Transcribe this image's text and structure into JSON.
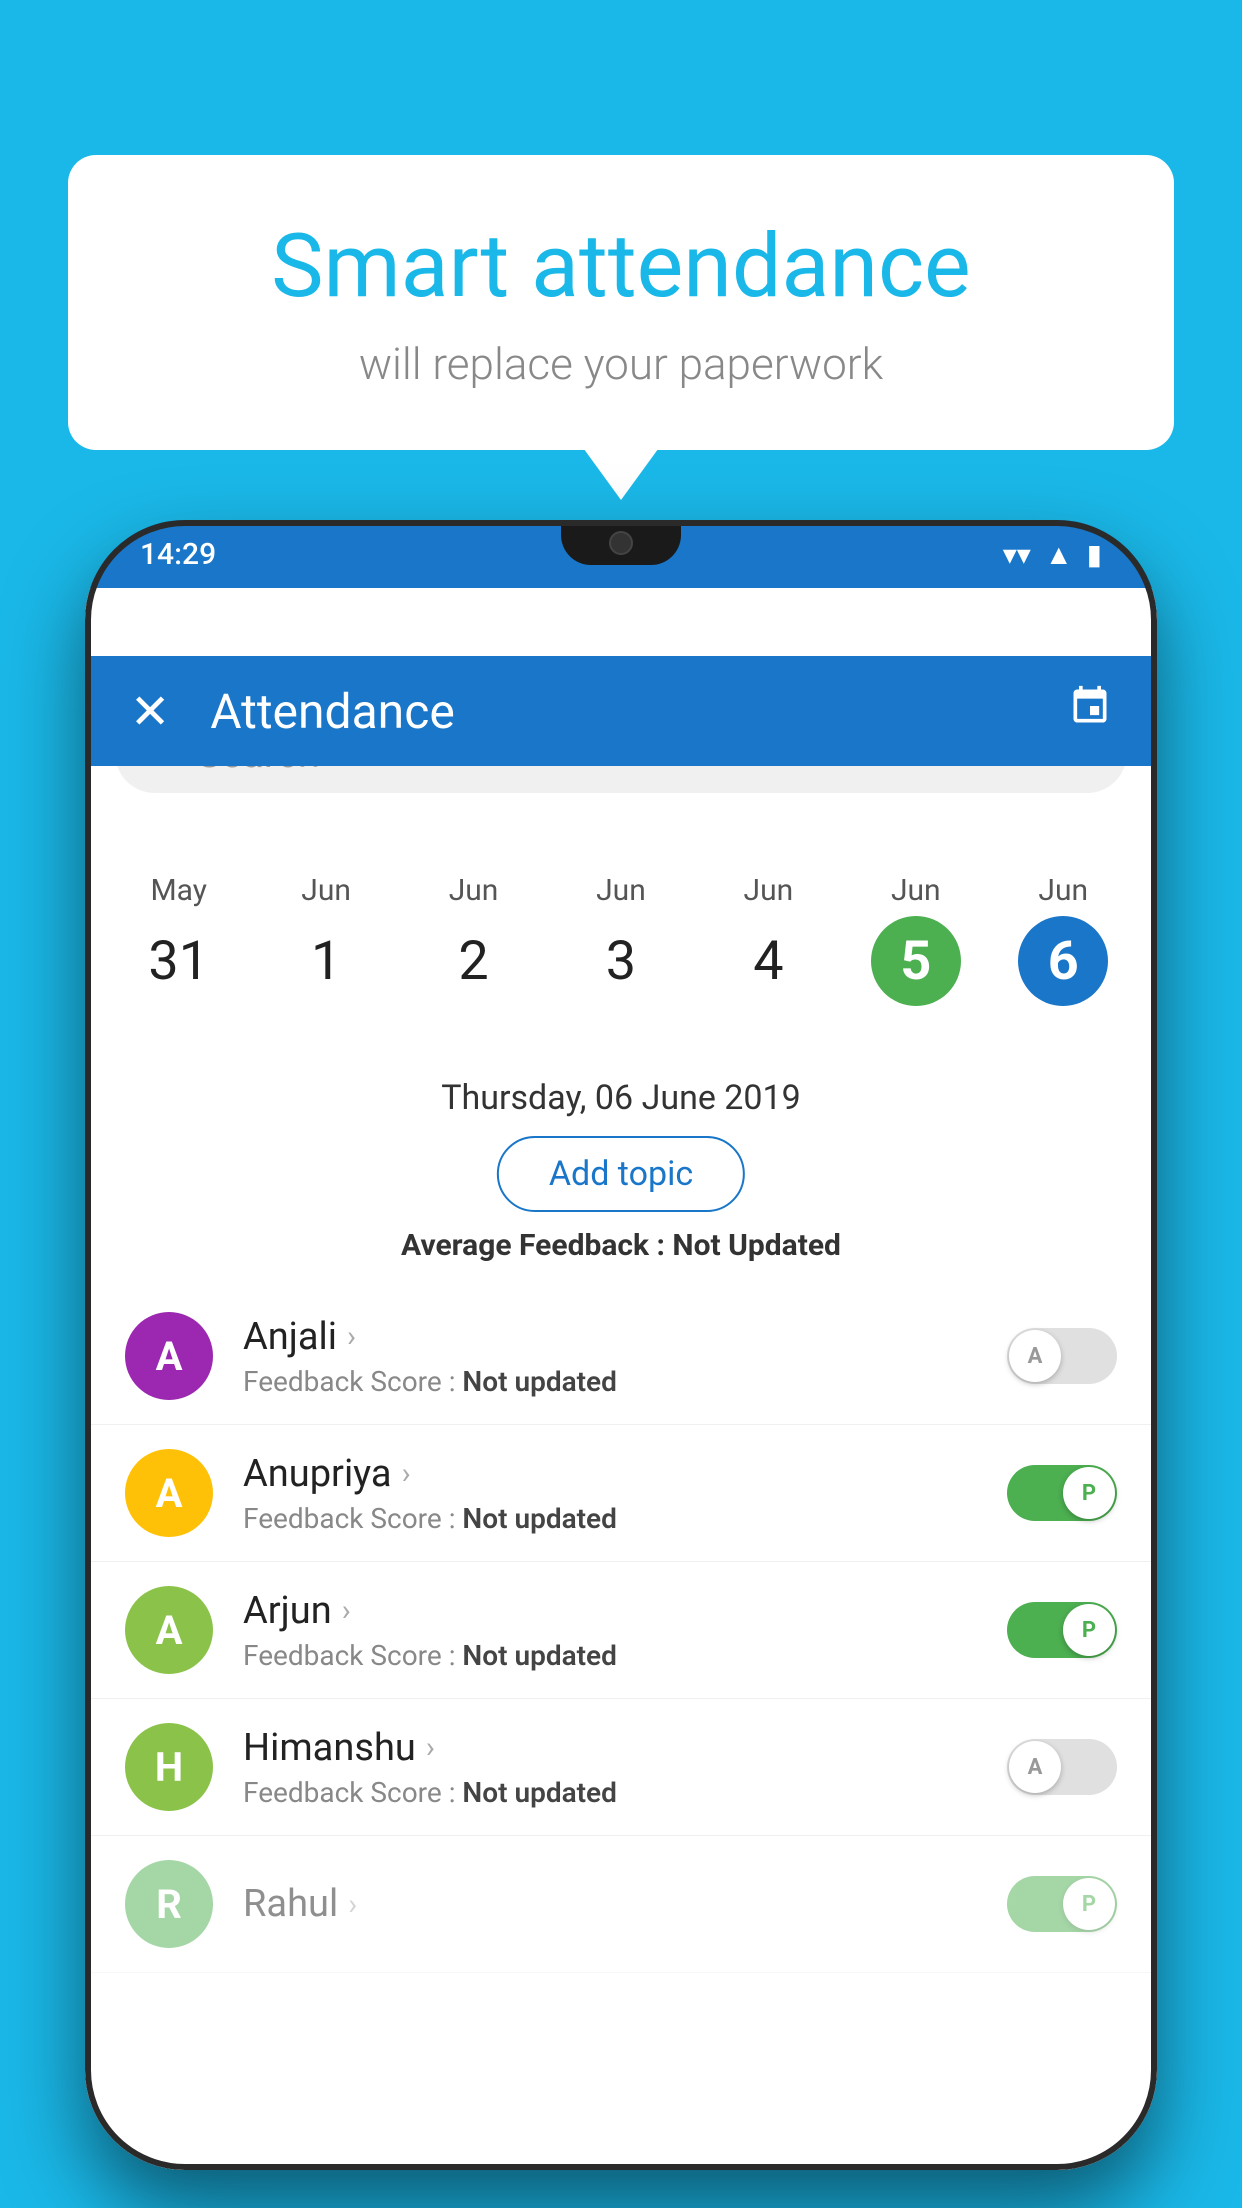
{
  "background": {
    "color": "#1ab8e8"
  },
  "speech_bubble": {
    "title": "Smart attendance",
    "subtitle": "will replace your paperwork"
  },
  "status_bar": {
    "time": "14:29",
    "wifi_icon": "▼",
    "signal_icon": "▲",
    "battery_icon": "▮"
  },
  "app_bar": {
    "title": "Attendance",
    "close_icon": "✕",
    "calendar_icon": "📅"
  },
  "search": {
    "placeholder": "Search"
  },
  "calendar": {
    "days": [
      {
        "month": "May",
        "num": "31",
        "style": "normal"
      },
      {
        "month": "Jun",
        "num": "1",
        "style": "normal"
      },
      {
        "month": "Jun",
        "num": "2",
        "style": "normal"
      },
      {
        "month": "Jun",
        "num": "3",
        "style": "normal"
      },
      {
        "month": "Jun",
        "num": "4",
        "style": "normal"
      },
      {
        "month": "Jun",
        "num": "5",
        "style": "green"
      },
      {
        "month": "Jun",
        "num": "6",
        "style": "blue"
      }
    ]
  },
  "selected_date": "Thursday, 06 June 2019",
  "add_topic_label": "Add topic",
  "avg_feedback_label": "Average Feedback :",
  "avg_feedback_value": "Not Updated",
  "students": [
    {
      "name": "Anjali",
      "avatar_letter": "A",
      "avatar_color": "#9c27b0",
      "feedback_label": "Feedback Score :",
      "feedback_value": "Not updated",
      "toggle_state": "off",
      "toggle_letter": "A"
    },
    {
      "name": "Anupriya",
      "avatar_letter": "A",
      "avatar_color": "#ffc107",
      "feedback_label": "Feedback Score :",
      "feedback_value": "Not updated",
      "toggle_state": "on",
      "toggle_letter": "P"
    },
    {
      "name": "Arjun",
      "avatar_letter": "A",
      "avatar_color": "#8bc34a",
      "feedback_label": "Feedback Score :",
      "feedback_value": "Not updated",
      "toggle_state": "on",
      "toggle_letter": "P"
    },
    {
      "name": "Himanshu",
      "avatar_letter": "H",
      "avatar_color": "#8bc34a",
      "feedback_label": "Feedback Score :",
      "feedback_value": "Not updated",
      "toggle_state": "off",
      "toggle_letter": "A"
    }
  ]
}
